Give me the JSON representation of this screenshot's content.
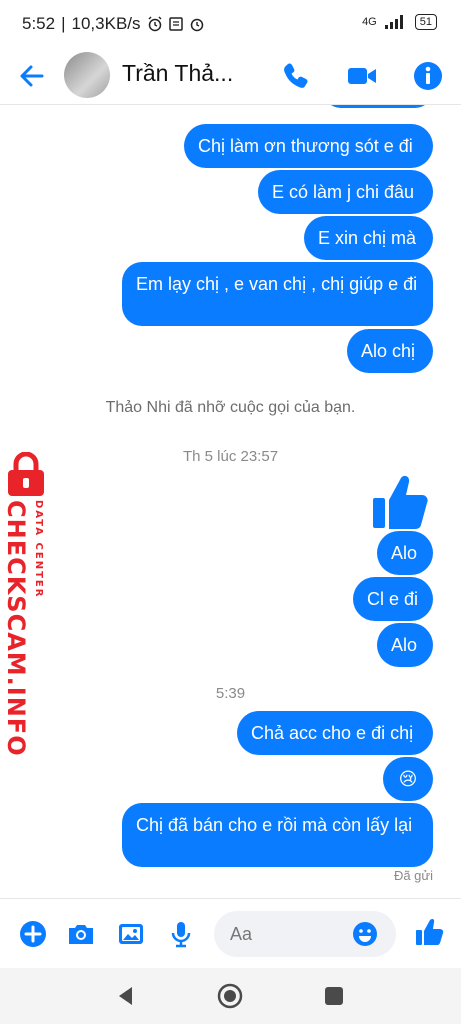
{
  "status": {
    "time": "5:52",
    "speed": "10,3KB/s",
    "network": "4G",
    "battery": "51"
  },
  "header": {
    "name": "Trần Thả..."
  },
  "messages": [
    {
      "text": "Chị làm ơn thương sót e đi"
    },
    {
      "text": "E có làm j chi đâu"
    },
    {
      "text": "E xin chị mà"
    },
    {
      "text": "Em lạy chị , e van chị , chị giúp e đi"
    },
    {
      "text": "Alo chị"
    },
    {
      "text": "Alo"
    },
    {
      "text": "Cl e đi"
    },
    {
      "text": "Alo"
    },
    {
      "text": "Chả acc cho e đi chị"
    },
    {
      "text": "😢"
    },
    {
      "text": "Chị đã bán cho e rồi mà còn lấy lại"
    }
  ],
  "system": {
    "missed_call": "Thảo Nhi đã nhỡ cuộc gọi của bạn.",
    "ts1": "Th 5 lúc 23:57",
    "ts2": "5:39",
    "sent": "Đã gửi"
  },
  "watermark": {
    "big": "CHECKSCAM.INFO",
    "small": "DATA CENTER"
  },
  "composer": {
    "placeholder": "Aa"
  },
  "colors": {
    "accent": "#0a7cff",
    "watermark": "#e8232a"
  }
}
